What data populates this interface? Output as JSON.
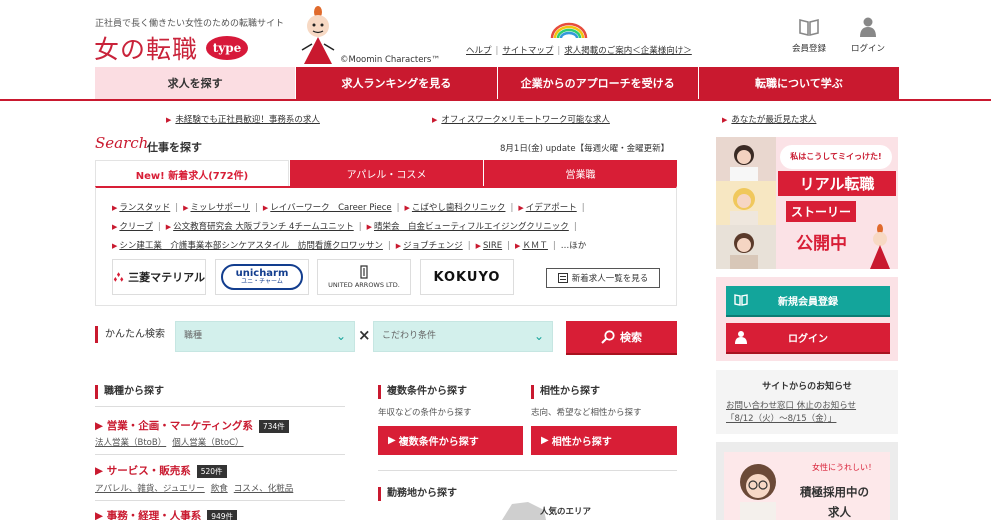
{
  "header": {
    "tagline": "正社員で長く働きたい女性のための転職サイト",
    "logo_text": "女の転職",
    "logo_badge": "type",
    "copyright": "©Moomin Characters™",
    "links": [
      "ヘルプ",
      "サイトマップ",
      "求人掲載のご案内＜企業様向け＞"
    ],
    "register_label": "会員登録",
    "login_label": "ログイン"
  },
  "nav": [
    "求人を探す",
    "求人ランキングを見る",
    "企業からのアプローチを受ける",
    "転職について学ぶ"
  ],
  "sublinks": [
    "未経験でも正社員歓迎！事務系の求人",
    "オフィスワーク×リモートワーク可能な求人",
    "あなたが最近見た求人"
  ],
  "search": {
    "script": "Search",
    "title": "仕事を探す",
    "update": "8月1日(金) update【毎週火曜・金曜更新】",
    "tabs": [
      "New! 新着求人(772件)",
      "アパレル・コスメ",
      "営業職"
    ],
    "companies": [
      [
        "ランスタッド",
        "ミッレサポーリ",
        "レイバーワーク　Career Piece",
        "こばやし歯科クリニック",
        "イデアポート"
      ],
      [
        "クリープ",
        "公文教育研究会 大阪ブランチ 4チームユニット",
        "晴栄会　白金ビューティフルエイジングクリニック"
      ],
      [
        "シン建工業　介護事業本部シンケアスタイル　訪問看護クロワッサン",
        "ジョブチェンジ",
        "SIRE",
        "ＫＭＴ"
      ]
    ],
    "more": "…ほか",
    "logos": [
      "三菱マテリアル",
      "unicharm",
      "UNITED ARROWS LTD.",
      "KOKUYO"
    ],
    "unicharm_kana": "ユニ・チャーム",
    "all_button": "新着求人一覧を見る"
  },
  "easy_search": {
    "label": "かんたん検索",
    "select1": "職種",
    "select2": "こだわり条件",
    "button": "検索"
  },
  "occupations": {
    "heading": "職種から探す",
    "items": [
      {
        "name": "営業・企画・マーケティング系",
        "count": "734件",
        "subs": [
          "法人営業（BtoB）",
          "個人営業（BtoC）"
        ]
      },
      {
        "name": "サービス・販売系",
        "count": "520件",
        "subs": [
          "アパレル、雑貨、ジュエリー",
          "飲食",
          "コスメ、化粧品"
        ]
      },
      {
        "name": "事務・経理・人事系",
        "count": "949件",
        "subs": []
      }
    ]
  },
  "multi": {
    "heading": "複数条件から探す",
    "desc": "年収などの条件から探す",
    "button": "複数条件から探す"
  },
  "affinity": {
    "heading": "相性から探す",
    "desc": "志向、希望など相性から探す",
    "button": "相性から探す"
  },
  "area": {
    "heading": "勤務地から探す",
    "popular": "人気のエリア"
  },
  "sidebar": {
    "banner_bubble": "私はこうしてミイっけた!",
    "banner_title": "リアル転職",
    "banner_sub": "ストーリー",
    "banner_open": "公開中",
    "register_button": "新規会員登録",
    "login_button": "ログイン",
    "notice_heading": "サイトからのお知らせ",
    "notice_text": [
      "お問い合わせ窓口 休止のお知らせ",
      "「8/12（火）～8/15（金）」"
    ],
    "banner2_a": "女性にうれしい！",
    "banner2_b": "積極採用中の",
    "banner2_c": "求人"
  },
  "colors": {
    "brand_red": "#c9192f",
    "button_red": "#d81e36",
    "teal": "#13a59b",
    "pink_bg": "#fbe2e6"
  }
}
